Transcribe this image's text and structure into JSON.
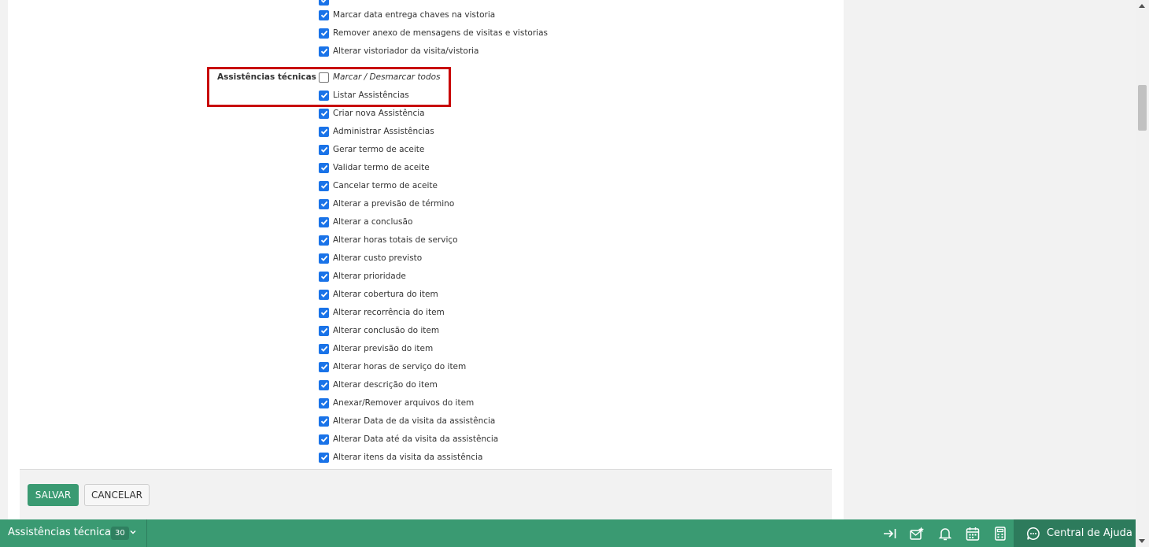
{
  "permissions": {
    "above": [
      "Marcar data entrega chaves na vistoria",
      "Remover anexo de mensagens de visitas e vistorias",
      "Alterar vistoriador da visita/vistoria"
    ],
    "section_label": "Assistências técnicas",
    "toggle_all": "Marcar / Desmarcar todos",
    "items": [
      "Listar Assistências",
      "Criar nova Assistência",
      "Administrar Assistências",
      "Gerar termo de aceite",
      "Validar termo de aceite",
      "Cancelar termo de aceite",
      "Alterar a previsão de término",
      "Alterar a conclusão",
      "Alterar horas totais de serviço",
      "Alterar custo previsto",
      "Alterar prioridade",
      "Alterar cobertura do item",
      "Alterar recorrência do item",
      "Alterar conclusão do item",
      "Alterar previsão do item",
      "Alterar horas de serviço do item",
      "Alterar descrição do item",
      "Anexar/Remover arquivos do item",
      "Alterar Data de da visita da assistência",
      "Alterar Data até da visita da assistência",
      "Alterar itens da visita da assistência"
    ]
  },
  "actions": {
    "save_label": "SALVAR",
    "cancel_label": "CANCELAR"
  },
  "taskbar": {
    "tab_label": "Assistências técnicas",
    "tab_count": "30",
    "help_label": "Central de Ajuda"
  },
  "colors": {
    "accent_green": "#3a9a72",
    "checkbox_blue": "#1a73e8",
    "highlight_red": "#c80000"
  },
  "icons": [
    "arrow-to-right-icon",
    "badge-star-icon",
    "bell-icon",
    "calendar-icon",
    "calculator-icon",
    "chat-bubble-icon",
    "chevron-down-icon",
    "checkmark-icon"
  ]
}
